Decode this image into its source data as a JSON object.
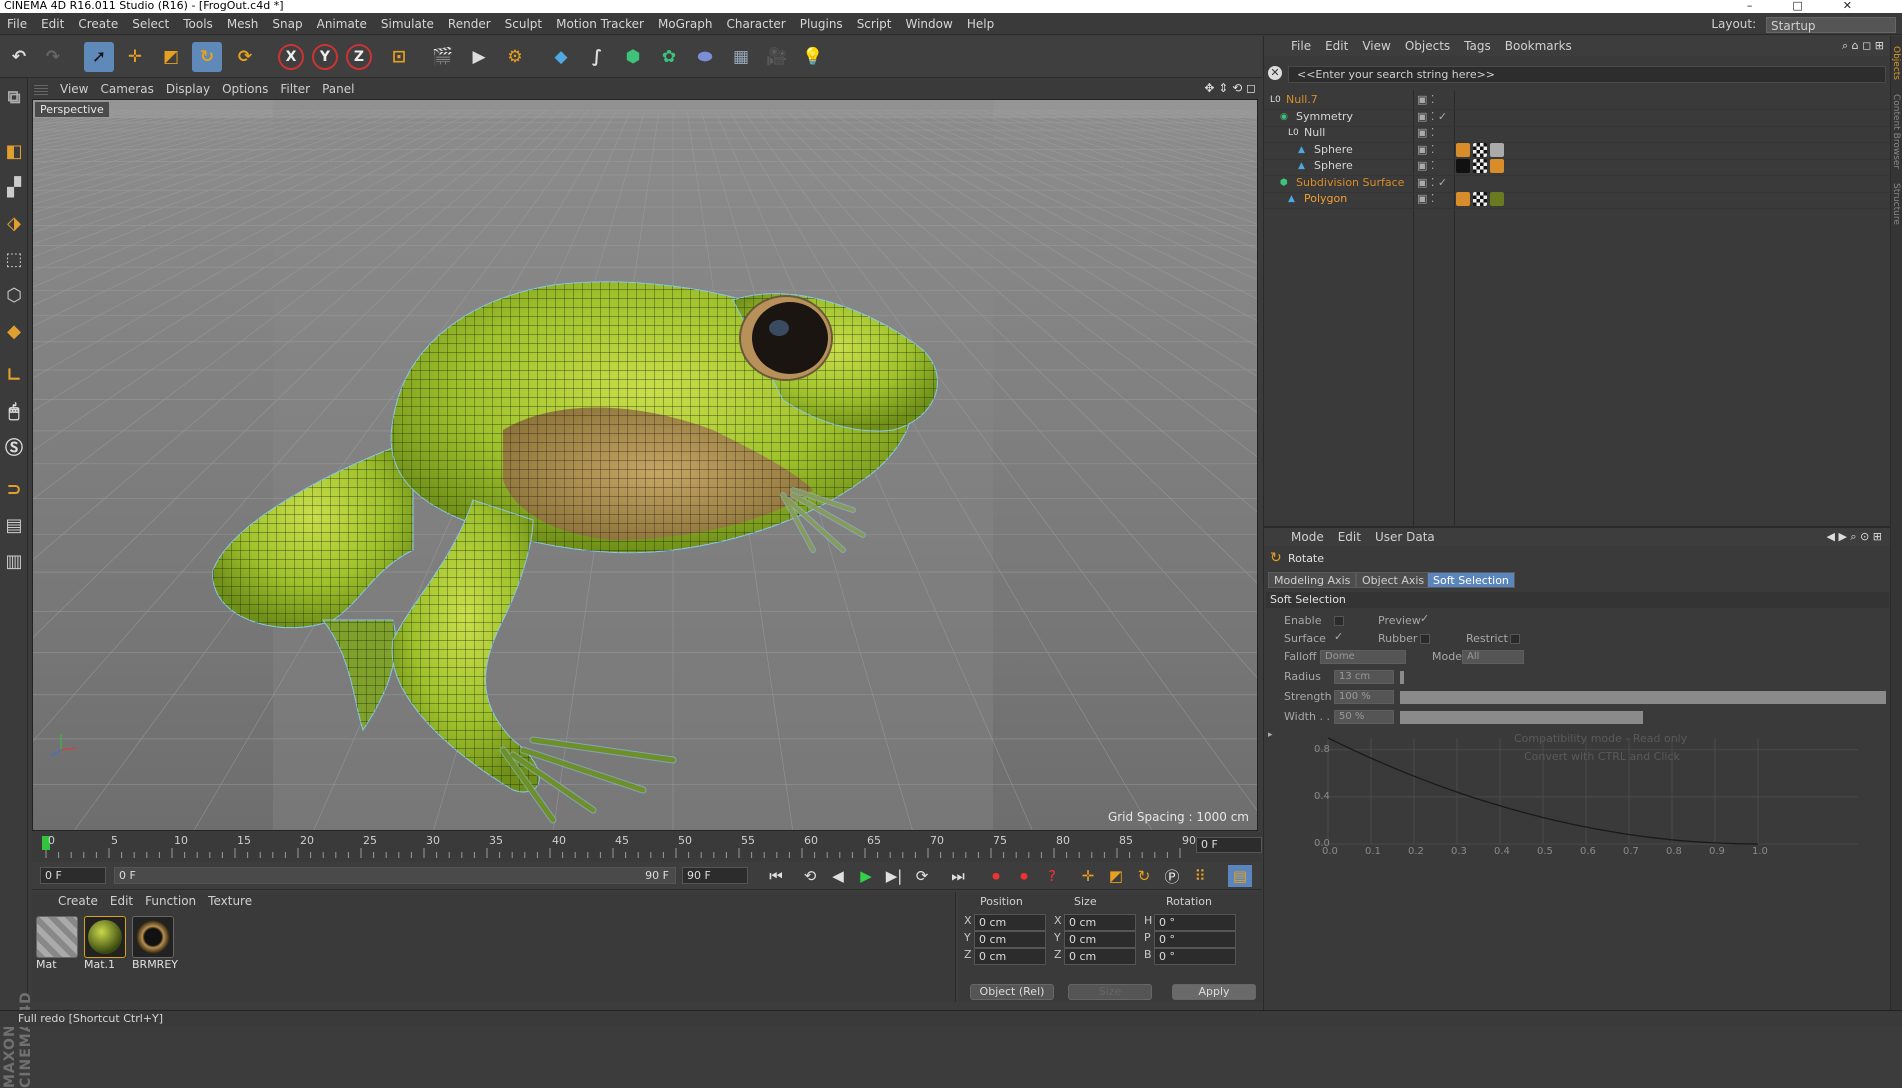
{
  "window": {
    "title": "CINEMA 4D R16.011 Studio (R16) - [FrogOut.c4d *]"
  },
  "menu": [
    "File",
    "Edit",
    "Create",
    "Select",
    "Tools",
    "Mesh",
    "Snap",
    "Animate",
    "Simulate",
    "Render",
    "Sculpt",
    "Motion Tracker",
    "MoGraph",
    "Character",
    "Plugins",
    "Script",
    "Window",
    "Help"
  ],
  "layout": {
    "label": "Layout:",
    "value": "Startup"
  },
  "viewport": {
    "menu": [
      "View",
      "Cameras",
      "Display",
      "Options",
      "Filter",
      "Panel"
    ],
    "label": "Perspective",
    "grid_spacing": "Grid Spacing : 1000 cm"
  },
  "timeline": {
    "ticks": [
      "0",
      "5",
      "10",
      "15",
      "20",
      "25",
      "30",
      "35",
      "40",
      "45",
      "50",
      "55",
      "60",
      "65",
      "70",
      "75",
      "80",
      "85",
      "90"
    ],
    "current_frame": "0 F",
    "start": "0 F",
    "range_start": "0 F",
    "range_end": "90 F",
    "end": "90 F"
  },
  "materials": {
    "menu": [
      "Create",
      "Edit",
      "Function",
      "Texture"
    ],
    "items": [
      {
        "name": "Mat"
      },
      {
        "name": "Mat.1"
      },
      {
        "name": "BRMREY"
      }
    ]
  },
  "coords": {
    "headers": {
      "position": "Position",
      "size": "Size",
      "rotation": "Rotation"
    },
    "rows": [
      {
        "axis": "X",
        "pos": "0 cm",
        "size_axis": "X",
        "size": "0 cm",
        "rot_axis": "H",
        "rot": "0 °"
      },
      {
        "axis": "Y",
        "pos": "0 cm",
        "size_axis": "Y",
        "size": "0 cm",
        "rot_axis": "P",
        "rot": "0 °"
      },
      {
        "axis": "Z",
        "pos": "0 cm",
        "size_axis": "Z",
        "size": "0 cm",
        "rot_axis": "B",
        "rot": "0 °"
      }
    ],
    "mode": "Object (Rel)",
    "size_mode": "Size",
    "apply": "Apply"
  },
  "status": "Full redo [Shortcut Ctrl+Y]",
  "object_manager": {
    "menu": [
      "File",
      "Edit",
      "View",
      "Objects",
      "Tags",
      "Bookmarks"
    ],
    "search_placeholder": "<<Enter your search string here>>",
    "objects": [
      {
        "name": "Null.7",
        "color": "#d98c2a"
      },
      {
        "name": "Symmetry",
        "color": "#d6d6d6"
      },
      {
        "name": "Null",
        "color": "#d6d6d6"
      },
      {
        "name": "Sphere",
        "color": "#d6d6d6"
      },
      {
        "name": "Sphere",
        "color": "#d6d6d6"
      },
      {
        "name": "Subdivision Surface",
        "color": "#d98c2a"
      },
      {
        "name": "Polygon",
        "color": "#f0a030"
      }
    ]
  },
  "attribute_manager": {
    "menu": [
      "Mode",
      "Edit",
      "User Data"
    ],
    "tool": "Rotate",
    "tabs": [
      "Modeling Axis",
      "Object Axis",
      "Soft Selection"
    ],
    "active_tab": "Soft Selection",
    "section": "Soft Selection",
    "labels": {
      "enable": "Enable",
      "preview": "Preview",
      "surface": "Surface",
      "rubber": "Rubber",
      "restrict": "Restrict",
      "falloff": "Falloff",
      "mode": "Mode",
      "radius": "Radius",
      "strength": "Strength",
      "width": "Width . ."
    },
    "values": {
      "falloff": "Dome",
      "mode": "All",
      "radius": "13 cm",
      "strength": "100 %",
      "width": "50 %"
    },
    "strength_fraction": 1.0,
    "width_fraction": 0.5,
    "graph_note1": "Compatibility mode - Read only",
    "graph_note2": "Convert with CTRL and Click",
    "graph_y": [
      "0.8",
      "0.4",
      "0.0"
    ],
    "graph_x": [
      "0.0",
      "0.1",
      "0.2",
      "0.3",
      "0.4",
      "0.5",
      "0.6",
      "0.7",
      "0.8",
      "0.9",
      "1.0"
    ]
  }
}
